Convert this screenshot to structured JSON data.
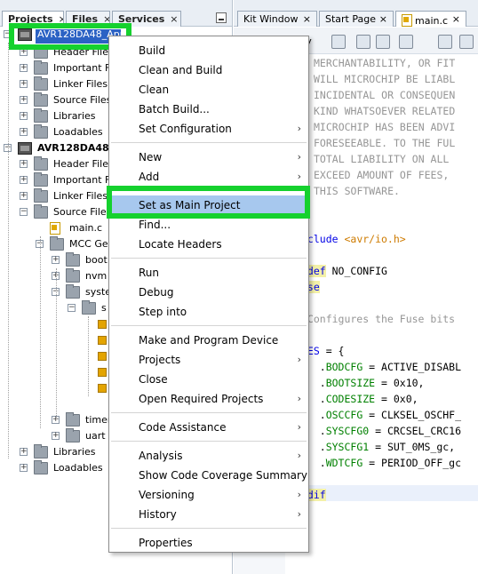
{
  "project_panel": {
    "tabs": [
      "Projects",
      "Files",
      "Services"
    ],
    "tab_close_glyph": "×",
    "expander_plus": "+",
    "expander_minus": "−",
    "tree": [
      {
        "label": "AVR128DA48_App",
        "depth": 0,
        "expander": "minus",
        "icon": "chip-icon",
        "bold": true,
        "selected": true
      },
      {
        "label": "Header Files",
        "depth": 1,
        "expander": "plus",
        "icon": "folder-icon"
      },
      {
        "label": "Important Files",
        "depth": 1,
        "expander": "plus",
        "icon": "folder-icon"
      },
      {
        "label": "Linker Files",
        "depth": 1,
        "expander": "plus",
        "icon": "folder-icon"
      },
      {
        "label": "Source Files",
        "depth": 1,
        "expander": "plus",
        "icon": "folder-icon"
      },
      {
        "label": "Libraries",
        "depth": 1,
        "expander": "plus",
        "icon": "folder-icon"
      },
      {
        "label": "Loadables",
        "depth": 1,
        "expander": "plus",
        "icon": "folder-icon"
      },
      {
        "label": "AVR128DA48_",
        "depth": 0,
        "expander": "minus",
        "icon": "chip-icon",
        "bold": true
      },
      {
        "label": "Header Files",
        "depth": 1,
        "expander": "plus",
        "icon": "folder-icon"
      },
      {
        "label": "Important Files",
        "depth": 1,
        "expander": "plus",
        "icon": "folder-icon"
      },
      {
        "label": "Linker Files",
        "depth": 1,
        "expander": "plus",
        "icon": "folder-icon"
      },
      {
        "label": "Source Files",
        "depth": 1,
        "expander": "minus",
        "icon": "folder-icon"
      },
      {
        "label": "main.c",
        "depth": 2,
        "expander": "none",
        "icon": "c-file-icon"
      },
      {
        "label": "MCC Ger",
        "depth": 2,
        "expander": "minus",
        "icon": "folder-icon"
      },
      {
        "label": "boot",
        "depth": 3,
        "expander": "plus",
        "icon": "folder-icon"
      },
      {
        "label": "nvm",
        "depth": 3,
        "expander": "plus",
        "icon": "folder-icon"
      },
      {
        "label": "syste",
        "depth": 3,
        "expander": "minus",
        "icon": "folder-icon"
      },
      {
        "label": "s",
        "depth": 4,
        "expander": "minus",
        "icon": "folder-icon"
      },
      {
        "label": "",
        "depth": 5,
        "expander": "none",
        "icon": "source-file-icon"
      },
      {
        "label": "",
        "depth": 5,
        "expander": "none",
        "icon": "source-file-icon"
      },
      {
        "label": "",
        "depth": 5,
        "expander": "none",
        "icon": "source-file-icon"
      },
      {
        "label": "",
        "depth": 5,
        "expander": "none",
        "icon": "source-file-icon"
      },
      {
        "label": "",
        "depth": 5,
        "expander": "none",
        "icon": "source-file-icon"
      },
      {
        "label": "timer",
        "depth": 3,
        "expander": "plus",
        "icon": "folder-icon"
      },
      {
        "label": "uart",
        "depth": 3,
        "expander": "plus",
        "icon": "folder-icon"
      },
      {
        "label": "Libraries",
        "depth": 1,
        "expander": "plus",
        "icon": "folder-icon"
      },
      {
        "label": "Loadables",
        "depth": 1,
        "expander": "plus",
        "icon": "folder-icon"
      }
    ]
  },
  "editor": {
    "tabs": [
      {
        "label": "Kit Window",
        "close": "×"
      },
      {
        "label": "Start Page",
        "close": "×"
      },
      {
        "label": "main.c",
        "close": "×",
        "active": true
      }
    ],
    "toolbar_label": "ory",
    "code_lines": [
      {
        "segments": [
          {
            "t": "MERCHANTABILITY, OR FIT",
            "c": "cm"
          }
        ]
      },
      {
        "segments": [
          {
            "t": "WILL MICROCHIP BE LIABL",
            "c": "cm"
          }
        ]
      },
      {
        "segments": [
          {
            "t": "INCIDENTAL OR CONSEQUEN",
            "c": "cm"
          }
        ]
      },
      {
        "segments": [
          {
            "t": "KIND WHATSOEVER RELATED",
            "c": "cm"
          }
        ]
      },
      {
        "segments": [
          {
            "t": "MICROCHIP HAS BEEN ADVI",
            "c": "cm"
          }
        ]
      },
      {
        "segments": [
          {
            "t": "FORESEEABLE. TO THE FUL",
            "c": "cm"
          }
        ]
      },
      {
        "segments": [
          {
            "t": "TOTAL LIABILITY ON ALL",
            "c": "cm"
          }
        ]
      },
      {
        "segments": [
          {
            "t": "EXCEED AMOUNT OF FEES,",
            "c": "cm"
          }
        ]
      },
      {
        "segments": [
          {
            "t": "THIS SOFTWARE.",
            "c": "cm"
          }
        ]
      },
      {
        "segments": []
      },
      {
        "segments": []
      },
      {
        "segments": [
          {
            "t": "nclude ",
            "c": "pp"
          },
          {
            "t": "<avr/io.h>",
            "c": "str"
          }
        ]
      },
      {
        "segments": []
      },
      {
        "segments": [
          {
            "t": "fdef",
            "c": "pp ppbg"
          },
          {
            "t": " NO_CONFIG",
            "c": ""
          }
        ]
      },
      {
        "segments": [
          {
            "t": "lse",
            "c": "pp ppbg"
          }
        ]
      },
      {
        "segments": []
      },
      {
        "segments": [
          {
            "t": " Configures the Fuse bits",
            "c": "cm"
          }
        ]
      },
      {
        "segments": []
      },
      {
        "segments": [
          {
            "t": "SES",
            "c": "kw"
          },
          {
            "t": " = {",
            "c": ""
          }
        ]
      },
      {
        "segments": [
          {
            "t": "   .",
            "c": ""
          },
          {
            "t": "BODCFG",
            "c": "fld"
          },
          {
            "t": " = ACTIVE_DISABL",
            "c": ""
          }
        ]
      },
      {
        "segments": [
          {
            "t": "   .",
            "c": ""
          },
          {
            "t": "BOOTSIZE",
            "c": "fld"
          },
          {
            "t": " = 0x10,",
            "c": ""
          }
        ]
      },
      {
        "segments": [
          {
            "t": "   .",
            "c": ""
          },
          {
            "t": "CODESIZE",
            "c": "fld"
          },
          {
            "t": " = 0x0,",
            "c": ""
          }
        ]
      },
      {
        "segments": [
          {
            "t": "   .",
            "c": ""
          },
          {
            "t": "OSCCFG",
            "c": "fld"
          },
          {
            "t": " = CLKSEL_OSCHF_",
            "c": ""
          }
        ]
      },
      {
        "segments": [
          {
            "t": "   .",
            "c": ""
          },
          {
            "t": "SYSCFG0",
            "c": "fld"
          },
          {
            "t": " = CRCSEL_CRC16",
            "c": ""
          }
        ]
      },
      {
        "segments": [
          {
            "t": "   .",
            "c": ""
          },
          {
            "t": "SYSCFG1",
            "c": "fld"
          },
          {
            "t": " = SUT_0MS_gc,",
            "c": ""
          }
        ]
      },
      {
        "segments": [
          {
            "t": "   .",
            "c": ""
          },
          {
            "t": "WDTCFG",
            "c": "fld"
          },
          {
            "t": " = PERIOD_OFF_gc",
            "c": ""
          }
        ]
      },
      {
        "segments": []
      },
      {
        "segments": [
          {
            "t": "ndif",
            "c": "pp ppbg"
          }
        ]
      }
    ]
  },
  "context_menu": {
    "submenu_arrow": "›",
    "items": [
      {
        "label": "Build"
      },
      {
        "label": "Clean and Build"
      },
      {
        "label": "Clean"
      },
      {
        "label": "Batch Build..."
      },
      {
        "label": "Set Configuration",
        "submenu": true
      },
      {
        "separator": true
      },
      {
        "label": "New",
        "submenu": true
      },
      {
        "label": "Add",
        "submenu": true
      },
      {
        "separator": true
      },
      {
        "label": "Set as Main Project",
        "highlighted": true
      },
      {
        "label": "Find..."
      },
      {
        "label": "Locate Headers"
      },
      {
        "separator": true
      },
      {
        "label": "Run"
      },
      {
        "label": "Debug"
      },
      {
        "label": "Step into"
      },
      {
        "separator": true
      },
      {
        "label": "Make and Program Device"
      },
      {
        "label": "Projects",
        "submenu": true
      },
      {
        "label": "Close"
      },
      {
        "label": "Open Required Projects",
        "submenu": true
      },
      {
        "separator": true
      },
      {
        "label": "Code Assistance",
        "submenu": true
      },
      {
        "separator": true
      },
      {
        "label": "Analysis",
        "submenu": true
      },
      {
        "label": "Show Code Coverage Summary"
      },
      {
        "label": "Versioning",
        "submenu": true
      },
      {
        "label": "History",
        "submenu": true
      },
      {
        "separator": true
      },
      {
        "label": "Properties"
      }
    ]
  },
  "colors": {
    "annotation_highlight": "#15d12e",
    "selection": "#2b62c4",
    "menu_hover": "#a7c8ee"
  }
}
